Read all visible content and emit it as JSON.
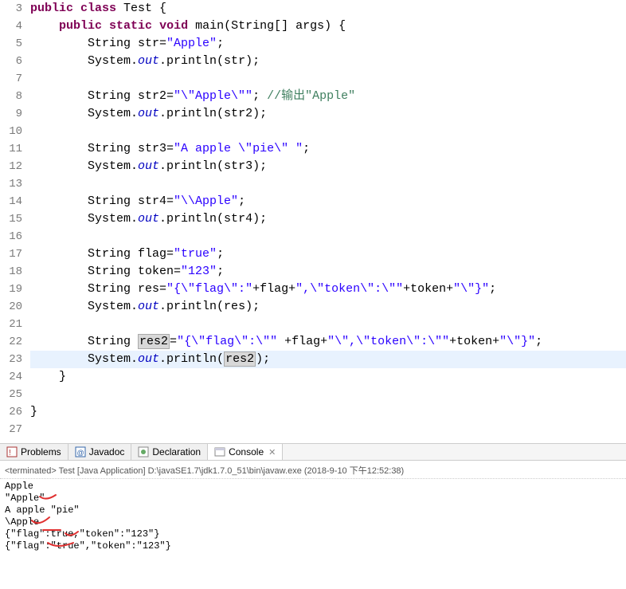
{
  "editor": {
    "lines": {
      "3": {
        "pre": "",
        "tokens": [
          {
            "c": "kw",
            "t": "public"
          },
          {
            "c": "",
            "t": " "
          },
          {
            "c": "kw",
            "t": "class"
          },
          {
            "c": "",
            "t": " Test {"
          }
        ]
      },
      "4": {
        "pre": "    ",
        "tokens": [
          {
            "c": "kw",
            "t": "public"
          },
          {
            "c": "",
            "t": " "
          },
          {
            "c": "kw",
            "t": "static"
          },
          {
            "c": "",
            "t": " "
          },
          {
            "c": "kw",
            "t": "void"
          },
          {
            "c": "",
            "t": " main(String[] args) {"
          }
        ]
      },
      "5": {
        "pre": "        ",
        "tokens": [
          {
            "c": "",
            "t": "String str="
          },
          {
            "c": "str",
            "t": "\"Apple\""
          },
          {
            "c": "",
            "t": ";"
          }
        ]
      },
      "6": {
        "pre": "        ",
        "tokens": [
          {
            "c": "",
            "t": "System."
          },
          {
            "c": "field",
            "t": "out"
          },
          {
            "c": "",
            "t": ".println(str);"
          }
        ]
      },
      "7": {
        "pre": "",
        "tokens": []
      },
      "8": {
        "pre": "        ",
        "tokens": [
          {
            "c": "",
            "t": "String str2="
          },
          {
            "c": "str",
            "t": "\"\\\"Apple\\\"\""
          },
          {
            "c": "",
            "t": "; "
          },
          {
            "c": "cmt",
            "t": "//输出\"Apple\""
          }
        ]
      },
      "9": {
        "pre": "        ",
        "tokens": [
          {
            "c": "",
            "t": "System."
          },
          {
            "c": "field",
            "t": "out"
          },
          {
            "c": "",
            "t": ".println(str2);"
          }
        ]
      },
      "10": {
        "pre": "",
        "tokens": []
      },
      "11": {
        "pre": "        ",
        "tokens": [
          {
            "c": "",
            "t": "String str3="
          },
          {
            "c": "str",
            "t": "\"A apple \\\"pie\\\" \""
          },
          {
            "c": "",
            "t": ";"
          }
        ]
      },
      "12": {
        "pre": "        ",
        "tokens": [
          {
            "c": "",
            "t": "System."
          },
          {
            "c": "field",
            "t": "out"
          },
          {
            "c": "",
            "t": ".println(str3);"
          }
        ]
      },
      "13": {
        "pre": "",
        "tokens": []
      },
      "14": {
        "pre": "        ",
        "tokens": [
          {
            "c": "",
            "t": "String str4="
          },
          {
            "c": "str",
            "t": "\"\\\\Apple\""
          },
          {
            "c": "",
            "t": ";"
          }
        ]
      },
      "15": {
        "pre": "        ",
        "tokens": [
          {
            "c": "",
            "t": "System."
          },
          {
            "c": "field",
            "t": "out"
          },
          {
            "c": "",
            "t": ".println(str4);"
          }
        ]
      },
      "16": {
        "pre": "",
        "tokens": []
      },
      "17": {
        "pre": "        ",
        "tokens": [
          {
            "c": "",
            "t": "String flag="
          },
          {
            "c": "str",
            "t": "\"true\""
          },
          {
            "c": "",
            "t": ";"
          }
        ]
      },
      "18": {
        "pre": "        ",
        "tokens": [
          {
            "c": "",
            "t": "String token="
          },
          {
            "c": "str",
            "t": "\"123\""
          },
          {
            "c": "",
            "t": ";"
          }
        ]
      },
      "19": {
        "pre": "        ",
        "tokens": [
          {
            "c": "",
            "t": "String res="
          },
          {
            "c": "str",
            "t": "\"{\\\"flag\\\":\""
          },
          {
            "c": "",
            "t": "+flag+"
          },
          {
            "c": "str",
            "t": "\",\\\"token\\\":\\\"\""
          },
          {
            "c": "",
            "t": "+token+"
          },
          {
            "c": "str",
            "t": "\"\\\"}\""
          },
          {
            "c": "",
            "t": ";"
          }
        ]
      },
      "20": {
        "pre": "        ",
        "tokens": [
          {
            "c": "",
            "t": "System."
          },
          {
            "c": "field",
            "t": "out"
          },
          {
            "c": "",
            "t": ".println(res);"
          }
        ]
      },
      "21": {
        "pre": "",
        "tokens": []
      },
      "22": {
        "pre": "        ",
        "tokens": [
          {
            "c": "",
            "t": "String "
          },
          {
            "c": "hlbox",
            "t": "res2"
          },
          {
            "c": "",
            "t": "="
          },
          {
            "c": "str",
            "t": "\"{\\\"flag\\\":\\\"\""
          },
          {
            "c": "",
            "t": " +flag+"
          },
          {
            "c": "str",
            "t": "\"\\\",\\\"token\\\":\\\"\""
          },
          {
            "c": "",
            "t": "+token+"
          },
          {
            "c": "str",
            "t": "\"\\\"}\""
          },
          {
            "c": "",
            "t": ";"
          }
        ]
      },
      "23": {
        "pre": "        ",
        "tokens": [
          {
            "c": "",
            "t": "System."
          },
          {
            "c": "field",
            "t": "out"
          },
          {
            "c": "",
            "t": ".println("
          },
          {
            "c": "hlbox",
            "t": "res2"
          },
          {
            "c": "",
            "t": ");"
          }
        ]
      },
      "24": {
        "pre": "    ",
        "tokens": [
          {
            "c": "",
            "t": "}"
          }
        ]
      },
      "25": {
        "pre": "",
        "tokens": []
      },
      "26": {
        "pre": "",
        "tokens": [
          {
            "c": "",
            "t": "}"
          }
        ]
      },
      "27": {
        "pre": "",
        "tokens": []
      }
    },
    "line_numbers": [
      "3",
      "4",
      "5",
      "6",
      "7",
      "8",
      "9",
      "10",
      "11",
      "12",
      "13",
      "14",
      "15",
      "16",
      "17",
      "18",
      "19",
      "20",
      "21",
      "22",
      "23",
      "24",
      "25",
      "26",
      "27"
    ],
    "current_line": "23"
  },
  "tabs": {
    "problems": "Problems",
    "javadoc": "Javadoc",
    "declaration": "Declaration",
    "console": "Console"
  },
  "terminated_line": "<terminated> Test [Java Application] D:\\javaSE1.7\\jdk1.7.0_51\\bin\\javaw.exe (2018-9-10 下午12:52:38)",
  "console_output": [
    "Apple",
    "\"Apple\"",
    "A apple \"pie\" ",
    "\\Apple",
    "{\"flag\":true,\"token\":\"123\"}",
    "{\"flag\":\"true\",\"token\":\"123\"}"
  ]
}
